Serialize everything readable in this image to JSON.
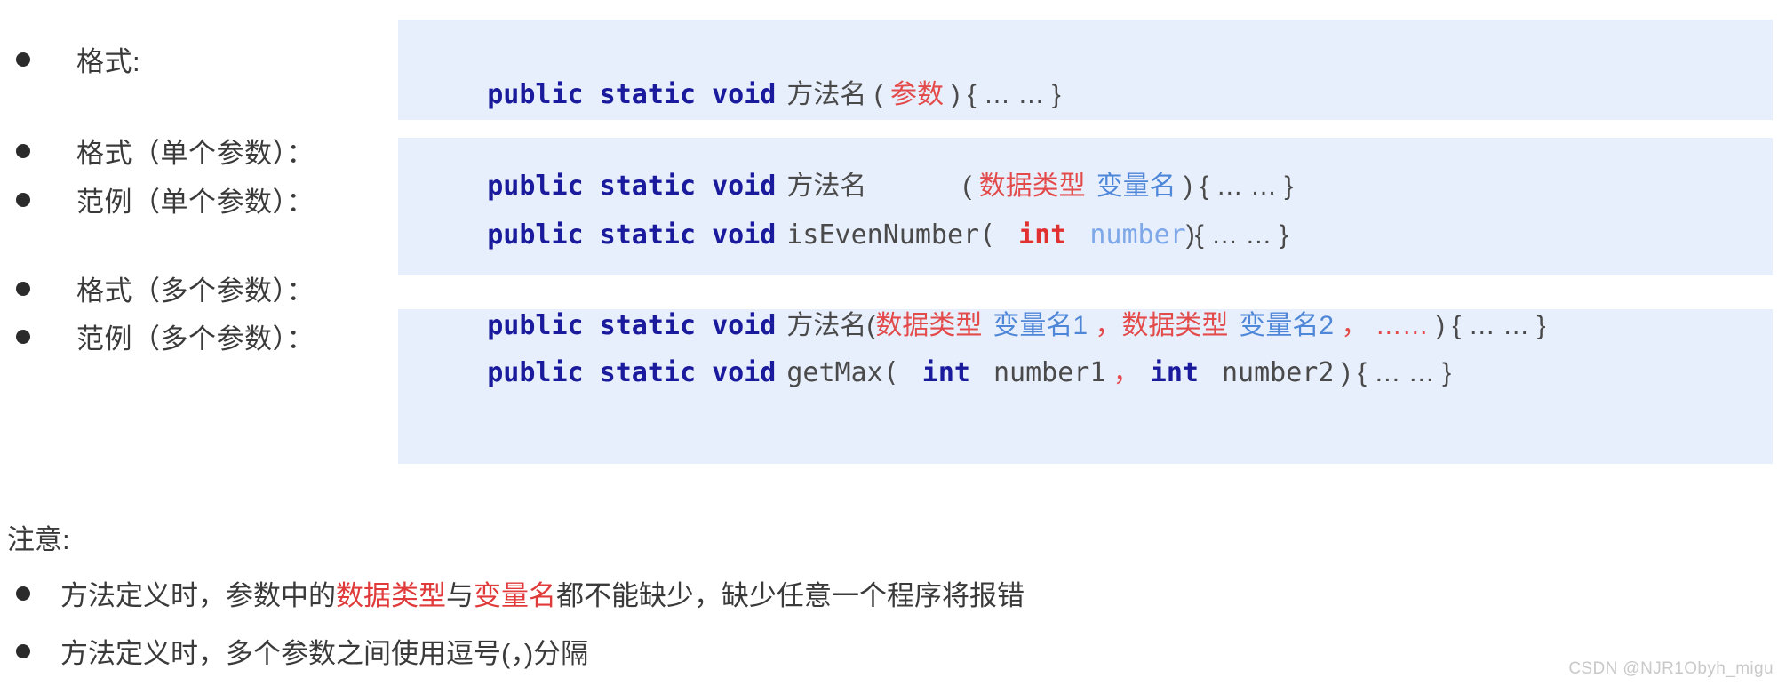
{
  "slide": {
    "labels": {
      "format_basic": "格式:",
      "format_single": "格式（单个参数）：",
      "example_single": "范例（单个参数）：",
      "format_multi": "格式（多个参数）：",
      "example_multi": "范例（多个参数）："
    },
    "code_blocks": [
      {
        "id": "block-basic",
        "lines": [
          {
            "id": "line-format-basic",
            "tokens": [
              {
                "text": "public static void",
                "style": "kw"
              },
              {
                "text": " ",
                "style": "space"
              },
              {
                "text": "方法名",
                "style": "cn"
              },
              {
                "text": " ( ",
                "style": "punct"
              },
              {
                "text": "参数",
                "style": "cn-red"
              },
              {
                "text": " ) { … … }",
                "style": "punct"
              }
            ],
            "plain": "public static void 方法名 ( 参数 ) { … … }"
          }
        ]
      },
      {
        "id": "block-single",
        "lines": [
          {
            "id": "line-format-single",
            "tokens": [
              {
                "text": "public static void",
                "style": "kw"
              },
              {
                "text": " ",
                "style": "space"
              },
              {
                "text": "方法名",
                "style": "cn"
              },
              {
                "text": "        ( ",
                "style": "punct"
              },
              {
                "text": "数据类型",
                "style": "cn-red"
              },
              {
                "text": " ",
                "style": "space"
              },
              {
                "text": "变量名",
                "style": "cn-blue"
              },
              {
                "text": " ) { … … }",
                "style": "punct"
              }
            ],
            "plain": "public static void 方法名        ( 数据类型 变量名 ) { … … }"
          },
          {
            "id": "line-example-single",
            "tokens": [
              {
                "text": "public static void",
                "style": "kw"
              },
              {
                "text": " ",
                "style": "space"
              },
              {
                "text": "isEvenNumber(",
                "style": "ident"
              },
              {
                "text": "  ",
                "style": "space"
              },
              {
                "text": "int",
                "style": "kw-int-red"
              },
              {
                "text": "   ",
                "style": "space"
              },
              {
                "text": "number",
                "style": "ident-blue"
              },
              {
                "text": "){ … … }",
                "style": "punct"
              }
            ],
            "plain": "public static void isEvenNumber(  int   number){ … … }"
          }
        ]
      },
      {
        "id": "block-multi",
        "lines": [
          {
            "id": "line-format-multi",
            "tokens": [
              {
                "text": "public static void",
                "style": "kw"
              },
              {
                "text": " ",
                "style": "space"
              },
              {
                "text": "方法名",
                "style": "cn"
              },
              {
                "text": " ( ",
                "style": "punct"
              },
              {
                "text": "数据类型",
                "style": "cn-red"
              },
              {
                "text": " ",
                "style": "space"
              },
              {
                "text": "变量名1",
                "style": "cn-blue"
              },
              {
                "text": " ，",
                "style": "punct-red"
              },
              {
                "text": " ",
                "style": "space"
              },
              {
                "text": "数据类型",
                "style": "cn-red"
              },
              {
                "text": " ",
                "style": "space"
              },
              {
                "text": "变量名2",
                "style": "cn-blue"
              },
              {
                "text": " ，",
                "style": "punct-red"
              },
              {
                "text": " ……",
                "style": "punct-red"
              },
              {
                "text": " ) { … … }",
                "style": "punct"
              }
            ],
            "plain": "public static void 方法名 ( 数据类型 变量名1 ， 数据类型 变量名2 ， …… ) { … … }"
          },
          {
            "id": "line-example-multi",
            "tokens": [
              {
                "text": "public static void",
                "style": "kw"
              },
              {
                "text": " ",
                "style": "space"
              },
              {
                "text": "getMax(",
                "style": "ident"
              },
              {
                "text": "  ",
                "style": "space"
              },
              {
                "text": "int",
                "style": "kw"
              },
              {
                "text": "  ",
                "style": "space"
              },
              {
                "text": "number1",
                "style": "ident"
              },
              {
                "text": " ，",
                "style": "punct-red"
              },
              {
                "text": "  ",
                "style": "space"
              },
              {
                "text": "int",
                "style": "kw"
              },
              {
                "text": "  ",
                "style": "space"
              },
              {
                "text": "number2",
                "style": "ident"
              },
              {
                "text": " ) { … … }",
                "style": "punct"
              }
            ],
            "plain": "public static void getMax(  int  number1 ，  int  number2 ) { … … }"
          }
        ]
      }
    ],
    "notes": {
      "title": "注意:",
      "items": [
        {
          "id": "note-1",
          "segments": [
            {
              "text": "方法定义时，参数中的",
              "highlight": false
            },
            {
              "text": "数据类型",
              "highlight": true
            },
            {
              "text": "与",
              "highlight": false
            },
            {
              "text": "变量名",
              "highlight": true
            },
            {
              "text": "都不能缺少，缺少任意一个程序将报错",
              "highlight": false
            }
          ],
          "plain": "方法定义时，参数中的数据类型与变量名都不能缺少，缺少任意一个程序将报错"
        },
        {
          "id": "note-2",
          "segments": [
            {
              "text": "方法定义时，多个参数之间使用逗号(，)分隔",
              "highlight": false
            }
          ],
          "plain": "方法定义时，多个参数之间使用逗号(，)分隔"
        }
      ]
    },
    "watermark": "CSDN @NJR1Obyh_migu",
    "colors": {
      "code_block_background": "#e8effc",
      "keyword_blue": "#1a1a9c",
      "accent_red": "#e03a3a",
      "variable_blue": "#4e86d8",
      "page_background": "#ffffff",
      "text_gray": "#3a3a3a"
    }
  }
}
